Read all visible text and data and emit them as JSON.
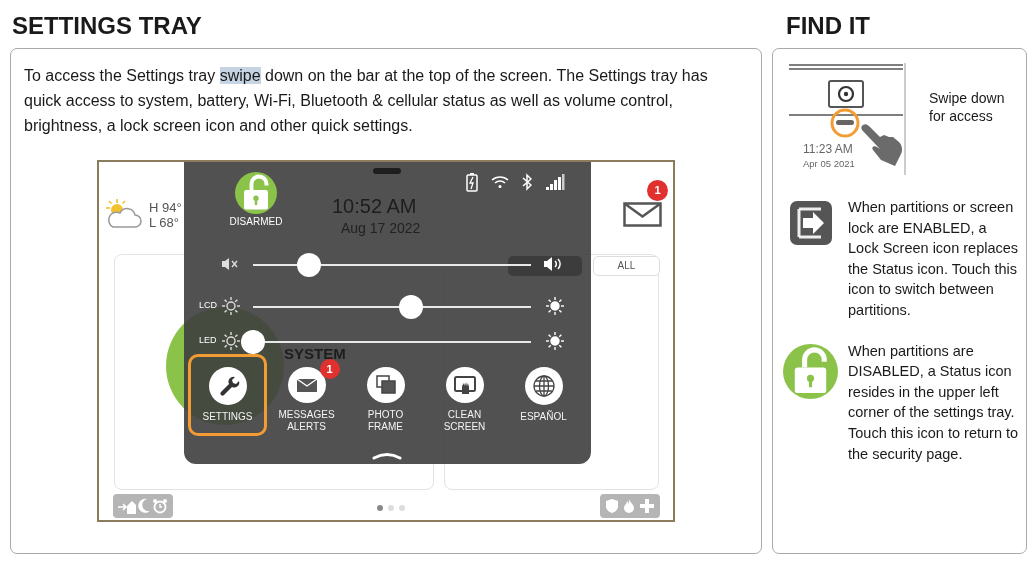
{
  "page_title": "SETTINGS TRAY",
  "intro": {
    "before": "To access the Settings tray ",
    "highlighted": "swipe",
    "after": " down on the bar at the top of the screen.  The Settings tray has quick access to system, battery, Wi-Fi, Bluetooth & cellular status as well as volume control, brightness, a lock screen icon and other quick settings."
  },
  "device": {
    "home": {
      "weather_high": "H 94°",
      "weather_low": "L 68°",
      "status_title": "SYSTEM",
      "filter_tab": "ALL",
      "message_badge": "1"
    },
    "tray": {
      "status": "DISARMED",
      "time": "10:52 AM",
      "date": "Aug 17 2022",
      "sliders": [
        {
          "kind": "volume",
          "level": 0.2
        },
        {
          "kind": "brightness",
          "label": "LCD",
          "level": 0.57
        },
        {
          "kind": "brightness",
          "label": "LED",
          "level": 0.0
        }
      ],
      "tiles": [
        {
          "kind": "settings",
          "label": "SETTINGS",
          "selected": true
        },
        {
          "kind": "messages",
          "label": "MESSAGES ALERTS",
          "selected": false,
          "badge": "1"
        },
        {
          "kind": "photo",
          "label": "PHOTO FRAME",
          "selected": false
        },
        {
          "kind": "clean",
          "label": "CLEAN SCREEN",
          "selected": false
        },
        {
          "kind": "language",
          "label": "ESPAÑOL",
          "selected": false
        }
      ]
    },
    "page_dots": [
      {
        "selected": true
      },
      {
        "selected": false
      },
      {
        "selected": false
      }
    ]
  },
  "find_it": {
    "title": "FIND IT",
    "clock_time": "11:23 AM",
    "clock_date": "Apr 05 2021",
    "swipe_hint": "Swipe down for access",
    "notes": [
      {
        "kind": "lock_screen",
        "text": "When partitions or screen lock are ENABLED, a Lock Screen icon replaces the Status icon. Touch this icon to switch between partitions."
      },
      {
        "kind": "status",
        "text": "When partitions are DISABLED, a Status icon resides in the upper left corner of the settings tray. Touch this icon to return to the security page."
      }
    ]
  }
}
